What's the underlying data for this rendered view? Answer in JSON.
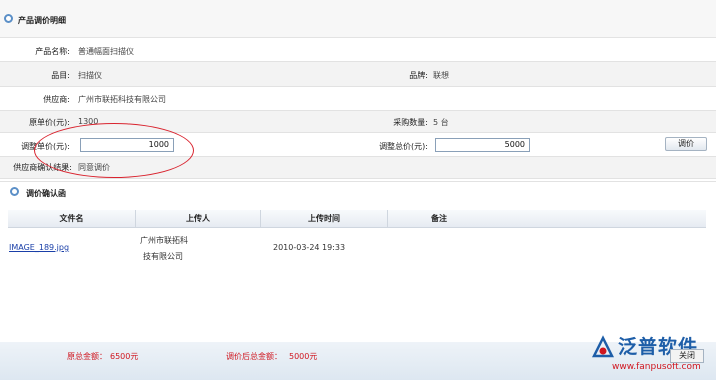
{
  "header": {
    "title": "产品调价明细"
  },
  "form": {
    "product_name_label": "产品名称:",
    "product_name_value": "普通幅面扫描仪",
    "category_label": "品目:",
    "category_value": "扫描仪",
    "brand_label": "品牌:",
    "brand_value": "联想",
    "supplier_label": "供应商:",
    "supplier_value": "广州市联拓科技有限公司",
    "orig_price_label": "原单价(元):",
    "orig_price_value": "1300",
    "purchase_qty_label": "采购数量:",
    "purchase_qty_value": "5 台",
    "adj_unit_price_label": "调整单价(元):",
    "adj_unit_price_value": "1000",
    "adj_total_label": "调整总价(元):",
    "adj_total_value": "5000",
    "adjust_button": "调价",
    "supplier_confirm_label": "供应商确认结果:",
    "supplier_confirm_value": "同意调价"
  },
  "confirm": {
    "title": "调价确认函",
    "columns": [
      "文件名",
      "上传人",
      "上传时间",
      "备注"
    ],
    "rows": [
      {
        "file": "IMAGE_189.jpg",
        "uploader_line1": "广州市联拓科",
        "uploader_line2": "技有限公司",
        "time": "2010-03-24 19:33",
        "note": ""
      }
    ]
  },
  "footer": {
    "orig_total_label": "原总金额：",
    "orig_total_value": "6500元",
    "new_total_label": "调价后总金额：",
    "new_total_value": "5000元",
    "close_button": "关闭"
  },
  "logo": {
    "name": "泛普软件",
    "url": "www.fanpusoft.com",
    "accent_blue": "#1e5ea8",
    "accent_red": "#d0161f"
  }
}
